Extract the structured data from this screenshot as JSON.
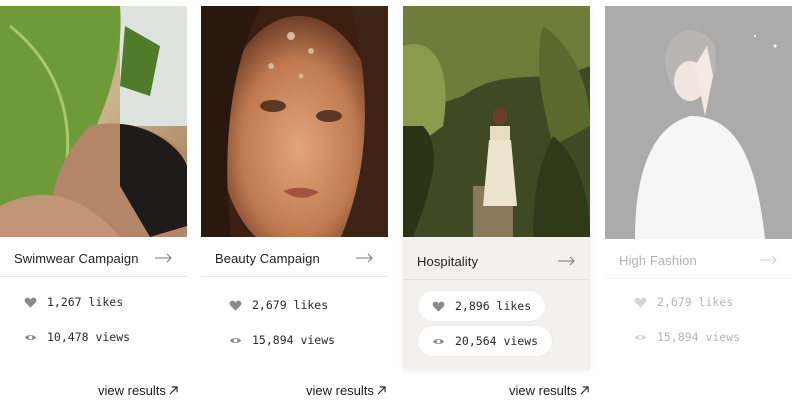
{
  "cards": [
    {
      "title": "Swimwear Campaign",
      "likes": "1,267 likes",
      "views": "10,478 views",
      "link": "view results",
      "state": "normal"
    },
    {
      "title": "Beauty Campaign",
      "likes": "2,679 likes",
      "views": "15,894 views",
      "link": "view results",
      "state": "normal"
    },
    {
      "title": "Hospitality",
      "likes": "2,896 likes",
      "views": "20,564 views",
      "link": "view results",
      "state": "hovered"
    },
    {
      "title": "High Fashion",
      "likes": "2,679 likes",
      "views": "15,894 views",
      "state": "faded"
    }
  ],
  "icons": {
    "arrow": "arrow-right-icon",
    "likes": "heart-icon",
    "views": "eye-icon",
    "link": "arrow-up-right-icon"
  },
  "colors": {
    "hover_bg": "#f3f1ee",
    "pill_bg": "#ffffff",
    "icon_gray": "#8a8a8a",
    "divider": "#e6e6e6"
  }
}
